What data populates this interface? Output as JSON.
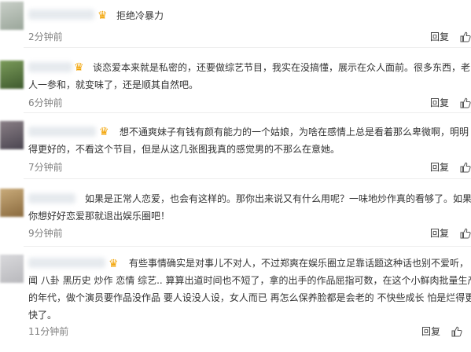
{
  "actions": {
    "reply_label": "回复"
  },
  "comments": [
    {
      "text": "拒绝冷暴力",
      "time": "2分钟前"
    },
    {
      "text": "谈恋爱本来就是私密的，还要做综艺节目，我实在没搞懂，展示在众人面前。很多东西，老\n人一参和，就变味了，还是顺其自然吧。",
      "time": "6分钟前"
    },
    {
      "text": "想不通爽妹子有钱有颜有能力的一个姑娘，为啥在感情上总是看着那么卑微啊，明明\n得更好的，不看这个节目，但是从这几张图我真的感觉男的不那么在意她。",
      "time": "7分钟前"
    },
    {
      "text": "如果是正常人恋爱，也会有这样的。那你出来说又有什么用呢？一味地炒作真的看够了。如果\n你想好好恋爱那就退出娱乐圈吧！",
      "time": "9分钟前"
    },
    {
      "text": "有些事情确实是对事儿不对人，不过郑爽在娱乐圈立足靠话题这种话也别不爱听，\n闻 八卦 黑历史 炒作 恋情 综艺.. 算算出道时间也不短了，拿的出手的作品屈指可数，在这个小鲜肉批量生产\n的年代，做个演员要作品没作品 要人设没人设，女人而已 再怎么保养脸都是会老的 不快些成长 怕是烂得更\n快了。",
      "time": "11分钟前"
    }
  ],
  "colors": {
    "text": "#333333",
    "time": "#808080",
    "crown": "#f2a200",
    "divider": "#eeeeee"
  },
  "icons": {
    "crown": "crown-icon",
    "like": "thumbs-up-icon"
  }
}
